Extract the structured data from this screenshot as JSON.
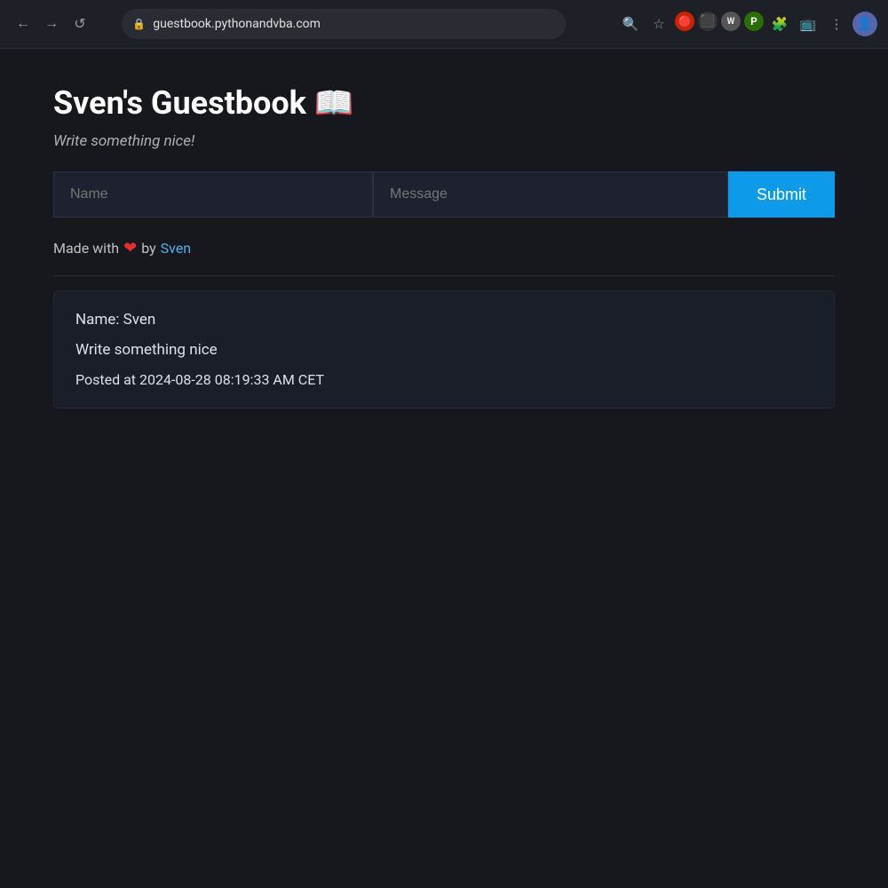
{
  "browser": {
    "url": "guestbook.pythonandvba.com",
    "back_label": "←",
    "forward_label": "→",
    "reload_label": "↺",
    "menu_label": "⋮"
  },
  "page": {
    "title": "Sven's Guestbook",
    "title_emoji": "📖",
    "subtitle": "Write something nice!",
    "form": {
      "name_placeholder": "Name",
      "message_placeholder": "Message",
      "submit_label": "Submit"
    },
    "attribution": {
      "prefix": "Made with",
      "heart": "❤",
      "by_text": "by",
      "author_name": "Sven",
      "author_url": "#"
    },
    "entries": [
      {
        "name_label": "Name:",
        "name_value": "Sven",
        "message": "Write something nice",
        "posted_prefix": "Posted at",
        "timestamp": "2024-08-28 08:19:33 AM CET"
      }
    ]
  }
}
